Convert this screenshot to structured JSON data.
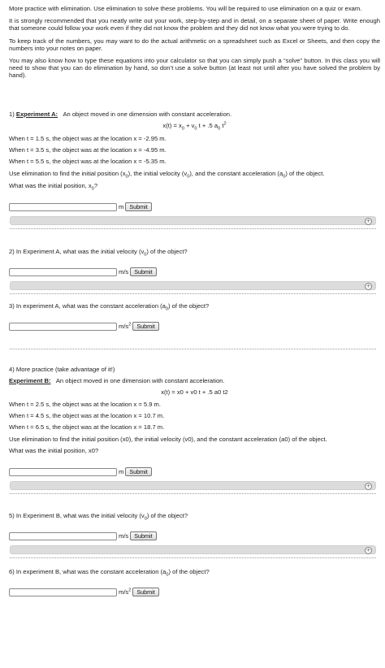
{
  "intro": [
    "More practice with elimination.  Use elimination to solve these problems. You will be required to use elimination on a quiz or exam.",
    "It is strongly recommended that you neatly write out your work, step-by-step and in detail, on a separate sheet of paper. Write enough that someone could follow your work even if they did not know the problem and they did not know what you were trying to do.",
    "To keep track of the numbers, you may want to do the actual arithmetic on a spreadsheet such as Excel or Sheets, and then copy the numbers into your notes on paper.",
    "You may also know how to type these equations into your calculator so that you can simply push a “solve” button. In this class you will need to show that you can do elimination by hand, so don’t use a solve button (at least not until after you have solved the problem by hand)."
  ],
  "q1": {
    "num": "1)",
    "exp_label": "Experiment A:",
    "desc": "An object moved in one dimension with constant acceleration.",
    "data": [
      "When t = 1.5 s, the object was at the location x = -2.95 m.",
      "When t = 3.5 s, the object was at the location x = -4.95 m.",
      "When t = 5.5 s, the object was at the location x = -5.35 m."
    ],
    "elim_a": "Use elimination to find the initial position (x",
    "elim_b": "), the initial velocity (v",
    "elim_c": "), and the constant acceleration (a",
    "elim_d": ") of the object.",
    "ask": "What was the initial position, x",
    "ask_end": "?",
    "unit": "m",
    "submit": "Submit"
  },
  "q2": {
    "text_a": "2) In Experiment A, what was the initial velocity (v",
    "text_b": ") of the object?",
    "unit": "m/s",
    "submit": "Submit"
  },
  "q3": {
    "text_a": "3) In experiment A, what was the constant acceleration (a",
    "text_b": ") of the object?",
    "unit": "m/s",
    "submit": "Submit"
  },
  "q4": {
    "title": "4) More practice (take advantage of it!)",
    "exp_label": "Experiment B:",
    "desc": "An object moved in one dimension with constant acceleration.",
    "equation": "x(t) = x0 + v0 t + .5 a0 t2",
    "data": [
      "When t = 2.5 s, the object was at the location x = 5.9 m.",
      "When t = 4.5 s, the object was at the location x = 10.7 m.",
      "When t = 6.5 s, the object was at the location x = 18.7 m."
    ],
    "elim": "Use elimination to find the initial position (x0), the initial velocity (v0), and the constant acceleration (a0) of the object.",
    "ask": "What was the initial position, x0?",
    "unit": "m",
    "submit": "Submit"
  },
  "q5": {
    "text_a": "5) In Experiment B, what was the initial velocity (v",
    "text_b": ") of the object?",
    "unit": "m/s",
    "submit": "Submit"
  },
  "q6": {
    "text_a": "6) In experiment B, what was the constant acceleration (a",
    "text_b": ") of the object?",
    "unit": "m/s",
    "submit": "Submit"
  },
  "eq": {
    "lhs": "x(t) = x",
    "p1": " + v",
    "p2": " t + .5 a",
    "p3": " t",
    "sub0": "0",
    "sup2": "2"
  },
  "expand_symbol": "+"
}
